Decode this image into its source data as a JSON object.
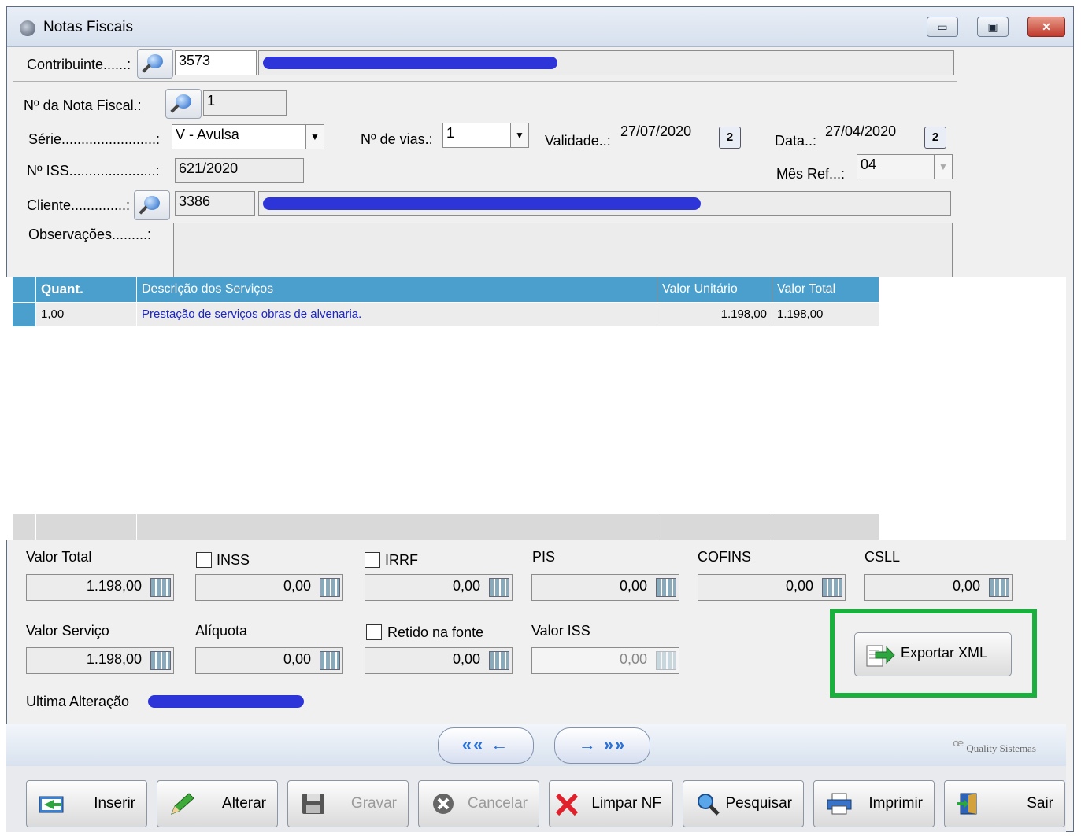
{
  "window": {
    "title": "Notas Fiscais",
    "minimize": "▭",
    "maximize": "▣",
    "close": "✕"
  },
  "form": {
    "contribuinte": {
      "label": "Contribuinte......:",
      "code": "3573"
    },
    "nota": {
      "label": "Nº da Nota Fiscal.:",
      "value": "1"
    },
    "serie": {
      "label": "Série........................:",
      "value": "V - Avulsa"
    },
    "vias": {
      "label": "Nº de vias.:",
      "value": "1"
    },
    "validade": {
      "label": "Validade..:",
      "value": "27/07/2020"
    },
    "data": {
      "label": "Data..:",
      "value": "27/04/2020"
    },
    "iss": {
      "label": "Nº ISS......................:",
      "value": "621/2020"
    },
    "mes_ref": {
      "label": "Mês Ref...:",
      "value": "04"
    },
    "cliente": {
      "label": "Cliente..............:",
      "code": "3386"
    },
    "observacoes": {
      "label": "Observações.........:",
      "value": ""
    },
    "calendar_glyph": "2",
    "dropdown_glyph": "▼"
  },
  "grid": {
    "headers": [
      "Quant.",
      "Descrição dos Serviços",
      "Valor Unitário",
      "Valor Total"
    ],
    "rows": [
      {
        "quant": "1,00",
        "descricao": "Prestação de serviços obras de alvenaria.",
        "unitario": "1.198,00",
        "total": "1.198,00"
      }
    ]
  },
  "totals": {
    "valor_total": {
      "label": "Valor Total",
      "value": "1.198,00"
    },
    "inss": {
      "label": "INSS",
      "value": "0,00"
    },
    "irrf": {
      "label": "IRRF",
      "value": "0,00"
    },
    "pis": {
      "label": "PIS",
      "value": "0,00"
    },
    "cofins": {
      "label": "COFINS",
      "value": "0,00"
    },
    "csll": {
      "label": "CSLL",
      "value": "0,00"
    },
    "valor_servico": {
      "label": "Valor Serviço",
      "value": "1.198,00"
    },
    "aliquota": {
      "label": "Alíquota",
      "value": "0,00"
    },
    "retido": {
      "label": "Retido na fonte",
      "value": "0,00"
    },
    "valor_iss": {
      "label": "Valor ISS",
      "value": "0,00"
    }
  },
  "export_button": "Exportar XML",
  "ultima_alteracao": {
    "label": "Ultima Alteração"
  },
  "nav": {
    "prev": "«« ←",
    "next": "→ »»"
  },
  "brand": "Quality Sistemas",
  "toolbar": {
    "inserir": "Inserir",
    "alterar": "Alterar",
    "gravar": "Gravar",
    "cancelar": "Cancelar",
    "limpar": "Limpar NF",
    "pesquisar": "Pesquisar",
    "imprimir": "Imprimir",
    "sair": "Sair"
  },
  "colors": {
    "grid_header": "#4a9fcc",
    "highlight": "#19b03d",
    "redaction": "#2e35d8",
    "row_text": "#1b25c8"
  }
}
